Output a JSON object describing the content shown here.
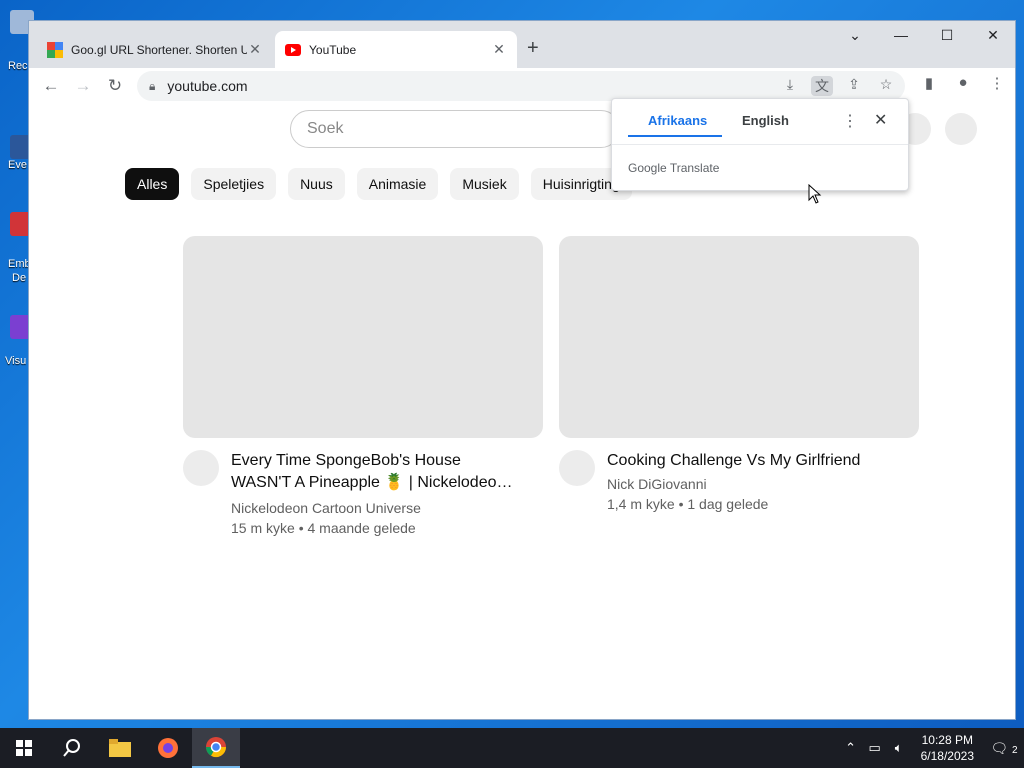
{
  "desktop": {
    "icons": [
      {
        "label": "Rec",
        "color": "#9fb8d9"
      },
      {
        "label": "Eve",
        "color": "#2b579a"
      },
      {
        "label": "Emb",
        "label2": "De",
        "color": "#d13438"
      },
      {
        "label": "Visu",
        "color": "#7b3fd1"
      }
    ]
  },
  "browser": {
    "tabs": [
      {
        "title": "Goo.gl URL Shortener. Shorten U",
        "active": false
      },
      {
        "title": "YouTube",
        "active": true
      }
    ],
    "address": "youtube.com",
    "window_controls": {
      "minimize": "—",
      "maximize": "☐",
      "close": "✕",
      "dropdown": "⌄"
    }
  },
  "youtube": {
    "search_placeholder": "Soek",
    "chips": [
      "Alles",
      "Speletjies",
      "Nuus",
      "Animasie",
      "Musiek",
      "Huisinrigting"
    ],
    "videos": [
      {
        "title": "Every Time SpongeBob's House WASN'T A Pineapple 🍍 | Nickelodeo…",
        "channel": "Nickelodeon Cartoon Universe",
        "stats": "15 m kyke • 4 maande gelede"
      },
      {
        "title": "Cooking Challenge Vs My Girlfriend",
        "channel": "Nick DiGiovanni",
        "stats": "1,4 m kyke • 1 dag gelede"
      }
    ]
  },
  "translate_popup": {
    "source_lang": "Afrikaans",
    "target_lang": "English",
    "brand": "Google Translate"
  },
  "taskbar": {
    "time": "10:28 PM",
    "date": "6/18/2023",
    "notification_count": "2"
  },
  "colors": {
    "accent": "#1a73e8",
    "youtube_red": "#ff0000",
    "chip_selected": "#0f0f0f"
  }
}
